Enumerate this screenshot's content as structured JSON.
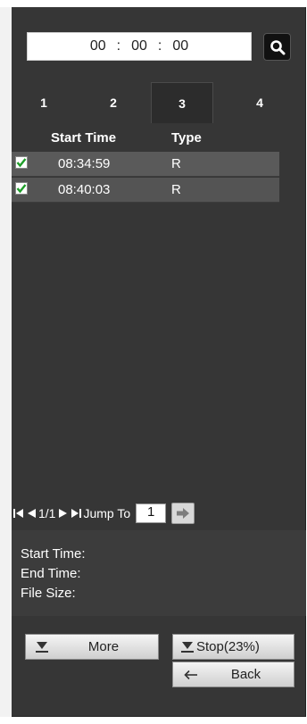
{
  "search": {
    "hour": "00",
    "minute": "00",
    "second": "00",
    "separator": ":",
    "icon": "search-icon"
  },
  "tabs": [
    {
      "label": "1"
    },
    {
      "label": "2"
    },
    {
      "label": "3",
      "active": true
    },
    {
      "label": "4"
    }
  ],
  "table": {
    "headers": {
      "start_time": "Start Time",
      "type": "Type"
    },
    "rows": [
      {
        "checked": true,
        "start_time": "08:34:59",
        "type": "R"
      },
      {
        "checked": true,
        "start_time": "08:40:03",
        "type": "R"
      }
    ]
  },
  "pager": {
    "page_text": "1/1",
    "jump_label": "Jump To",
    "jump_value": "1"
  },
  "info": {
    "start_time_label": "Start Time:",
    "end_time_label": "End Time:",
    "file_size_label": "File Size:"
  },
  "buttons": {
    "more": "More",
    "stop": "Stop(23%)",
    "back": "Back"
  },
  "colors": {
    "panel_bg": "#363636",
    "row_bg": "#5a5a5a",
    "checkbox_green": "#1f9e2a"
  }
}
